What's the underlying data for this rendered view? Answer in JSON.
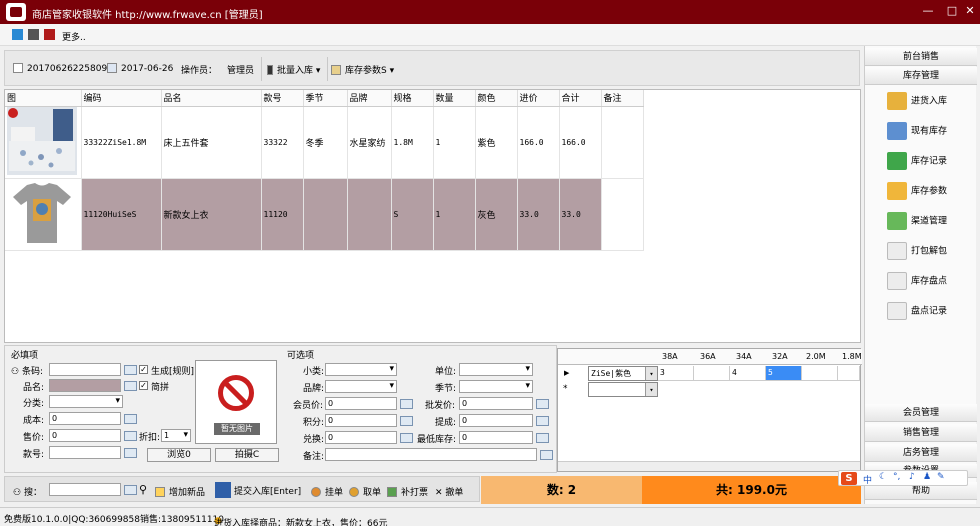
{
  "window": {
    "title": "商店管家收银软件 http://www.frwave.cn  [管理员]"
  },
  "skin": {
    "colors": [
      "#2a8ad4",
      "#555555",
      "#b01b1b"
    ],
    "more_label": "更多.."
  },
  "toolbar": {
    "doc_no": "20170626225809",
    "date": "2017-06-26",
    "operator_label": "操作员：",
    "operator": "管理员",
    "batch_label": "批量入库",
    "params_label": "库存参数S"
  },
  "table": {
    "columns": [
      "图",
      "编码",
      "品名",
      "款号",
      "季节",
      "品牌",
      "规格",
      "数量",
      "颜色",
      "进价",
      "合计",
      "备注"
    ],
    "rows": [
      {
        "code": "33322ZiSe1.8M",
        "name": "床上五件套",
        "style": "33322",
        "season": "冬季",
        "brand": "水星家纺",
        "spec": "1.8M",
        "qty": "1",
        "color": "紫色",
        "cost": "166.0",
        "total": "166.0",
        "note": ""
      },
      {
        "code": "11120HuiSeS",
        "name": "新款女上衣",
        "style": "11120",
        "season": "",
        "brand": "",
        "spec": "S",
        "qty": "1",
        "color": "灰色",
        "cost": "33.0",
        "total": "33.0",
        "note": ""
      }
    ]
  },
  "required": {
    "group_label": "必填项",
    "barcode_label": "条码:",
    "name_label": "品名:",
    "category_label": "分类:",
    "cost_label": "成本:",
    "cost_value": "0",
    "price_label": "售价:",
    "price_value": "0",
    "style_label": "款号:",
    "gen_label": "生成[规则]",
    "pinyin_label": "简拼",
    "discount_label": "折扣:",
    "discount_value": "1",
    "photo_text": "暂无图片",
    "browse_label": "浏览0",
    "shoot_label": "拍摄C"
  },
  "optional": {
    "group_label": "可选项",
    "subcat_label": "小类:",
    "brand_label": "品牌:",
    "member_price_label": "会员价:",
    "member_price_value": "0",
    "points_label": "积分:",
    "points_value": "0",
    "exchange_label": "兑换:",
    "exchange_value": "0",
    "note_label": "备注:",
    "unit_label": "单位:",
    "season_label": "季节:",
    "wholesale_label": "批发价:",
    "wholesale_value": "0",
    "commission_label": "提成:",
    "commission_value": "0",
    "min_stock_label": "最低库存:",
    "min_stock_value": "0"
  },
  "size_grid": {
    "headers": [
      "38A",
      "36A",
      "34A",
      "32A",
      "2.0M",
      "1.8M"
    ],
    "row_color": "ZiSe|紫色",
    "values": [
      "3",
      "",
      "4",
      "5",
      "",
      ""
    ],
    "new_row_marker": "*"
  },
  "bottom": {
    "search_label": "搜：",
    "add_label": "增加新品",
    "submit_label": "提交入库[Enter]",
    "hold_label": "挂单",
    "retrieve_label": "取单",
    "reprint_label": "补打票",
    "cancel_label": "撤单",
    "count_text": "数: 2",
    "total_text": "共: 199.0元"
  },
  "status": {
    "version": "免费版10.1.0.0|QQ:360699858销售:13809511110",
    "message": "进货入库择商品：新款女上衣，售价：66元"
  },
  "right_panel": {
    "front_sales": "前台销售",
    "inventory": "库存管理",
    "items": [
      "进货入库",
      "现有库存",
      "库存记录",
      "库存参数",
      "渠道管理",
      "打包解包",
      "库存盘点",
      "盘点记录"
    ],
    "member": "会员管理",
    "sales": "销售管理",
    "store": "店务管理",
    "params": "参数设置",
    "help": "帮助"
  },
  "ime": {
    "label": "中"
  }
}
